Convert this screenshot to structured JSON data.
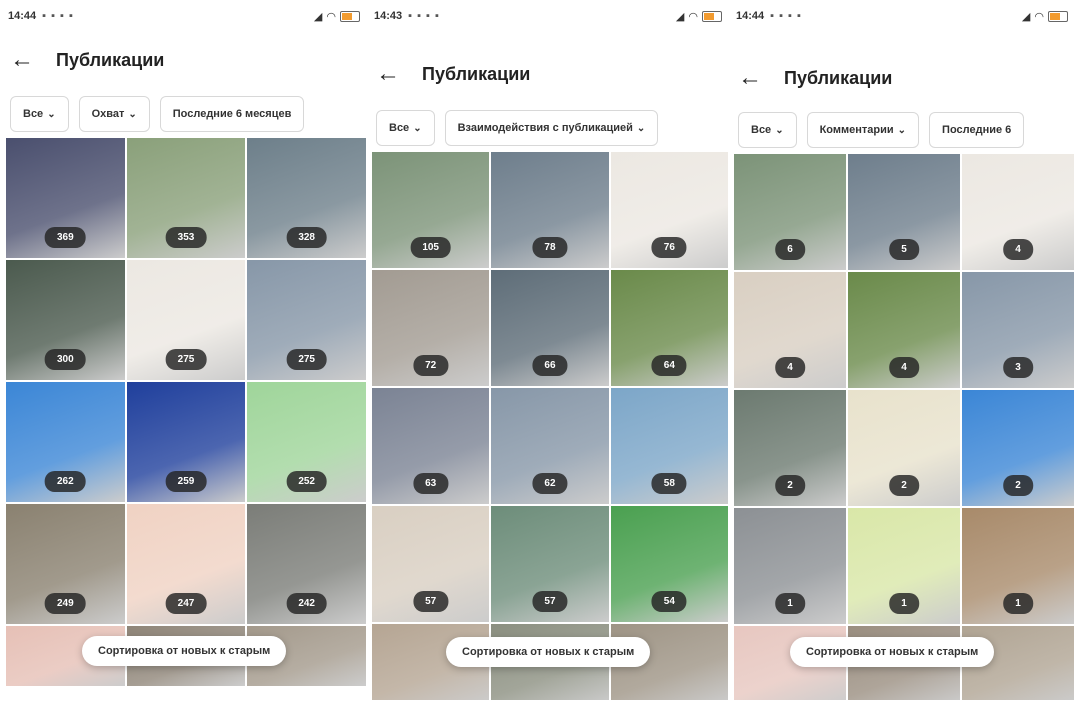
{
  "screens": [
    {
      "status_time": "14:44",
      "title": "Публикации",
      "filters": [
        "Все",
        "Охват",
        "Последние 6 месяцев"
      ],
      "toast": "Сортировка от новых к старым",
      "tiles": [
        {
          "count": "369",
          "bg": "#4a4f6e"
        },
        {
          "count": "353",
          "bg": "#8aa07a"
        },
        {
          "count": "328",
          "bg": "#6d7f8a"
        },
        {
          "count": "300",
          "bg": "#4b5a4e"
        },
        {
          "count": "275",
          "bg": "#ece8e2"
        },
        {
          "count": "275",
          "bg": "#8797a8"
        },
        {
          "count": "262",
          "bg": "#3b86d6"
        },
        {
          "count": "259",
          "bg": "#1f3f9c"
        },
        {
          "count": "252",
          "bg": "#9fd59a"
        },
        {
          "count": "249",
          "bg": "#8a8170"
        },
        {
          "count": "247",
          "bg": "#f0d2c3"
        },
        {
          "count": "242",
          "bg": "#7b7d78"
        },
        {
          "count": "",
          "bg": "#e6c0b6"
        },
        {
          "count": "",
          "bg": "#8f8578"
        },
        {
          "count": "",
          "bg": "#a3998b"
        }
      ]
    },
    {
      "status_time": "14:43",
      "title": "Публикации",
      "filters": [
        "Все",
        "Взаимодействия с публикацией"
      ],
      "toast": "Сортировка от новых к старым",
      "tiles": [
        {
          "count": "105",
          "bg": "#7c9378"
        },
        {
          "count": "78",
          "bg": "#6e7e8c"
        },
        {
          "count": "76",
          "bg": "#ece8e2"
        },
        {
          "count": "72",
          "bg": "#a29b92"
        },
        {
          "count": "66",
          "bg": "#5e6d78"
        },
        {
          "count": "64",
          "bg": "#6a8a4a"
        },
        {
          "count": "63",
          "bg": "#7b8394"
        },
        {
          "count": "62",
          "bg": "#8797a8"
        },
        {
          "count": "58",
          "bg": "#7ca6c8"
        },
        {
          "count": "57",
          "bg": "#d9cfc2"
        },
        {
          "count": "57",
          "bg": "#6d8d7a"
        },
        {
          "count": "54",
          "bg": "#4aa050"
        },
        {
          "count": "",
          "bg": "#b5a593"
        },
        {
          "count": "",
          "bg": "#8b8f80"
        },
        {
          "count": "",
          "bg": "#9e9485"
        }
      ]
    },
    {
      "status_time": "14:44",
      "title": "Публикации",
      "filters": [
        "Все",
        "Комментарии",
        "Последние 6"
      ],
      "toast": "Сортировка от новых к старым",
      "tiles": [
        {
          "count": "6",
          "bg": "#7c9378"
        },
        {
          "count": "5",
          "bg": "#6e7e8c"
        },
        {
          "count": "4",
          "bg": "#ece8e2"
        },
        {
          "count": "4",
          "bg": "#d9cfc2"
        },
        {
          "count": "4",
          "bg": "#6a8a4a"
        },
        {
          "count": "3",
          "bg": "#8797a8"
        },
        {
          "count": "2",
          "bg": "#6c7a70"
        },
        {
          "count": "2",
          "bg": "#e8e2cc"
        },
        {
          "count": "2",
          "bg": "#3b86d6"
        },
        {
          "count": "1",
          "bg": "#8c9094"
        },
        {
          "count": "1",
          "bg": "#d9e7a8"
        },
        {
          "count": "1",
          "bg": "#a88a6a"
        },
        {
          "count": "",
          "bg": "#e7c7c0"
        },
        {
          "count": "",
          "bg": "#9a8e80"
        },
        {
          "count": "",
          "bg": "#b0a493"
        }
      ]
    }
  ]
}
